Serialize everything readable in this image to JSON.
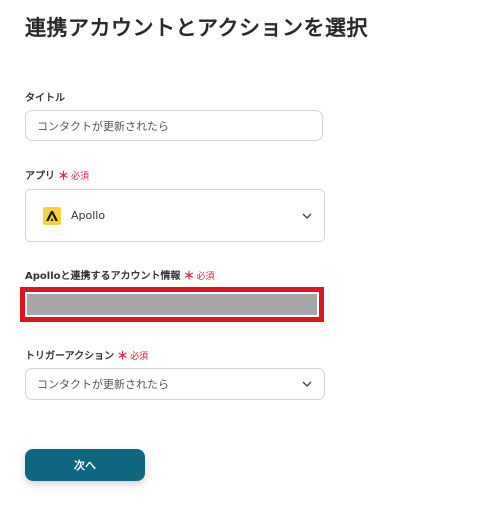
{
  "page": {
    "title": "連携アカウントとアクションを選択"
  },
  "form": {
    "title_field": {
      "label": "タイトル",
      "value": "コンタクトが更新されたら"
    },
    "app_field": {
      "label": "アプリ",
      "required_mark": "＊",
      "required_text": "必須",
      "selected_app": "Apollo",
      "icon": "apollo-logo-icon"
    },
    "account_field": {
      "label": "Apolloと連携するアカウント情報",
      "required_mark": "＊",
      "required_text": "必須"
    },
    "trigger_field": {
      "label": "トリガーアクション",
      "required_mark": "＊",
      "required_text": "必須",
      "selected_value": "コンタクトが更新されたら"
    },
    "next_button_label": "次へ"
  },
  "colors": {
    "primary_button": "#0f6680",
    "required": "#e0223a",
    "highlight_border": "#e0161e",
    "redacted_fill": "#a5a7ab",
    "apollo_logo": "#f7d23a"
  }
}
